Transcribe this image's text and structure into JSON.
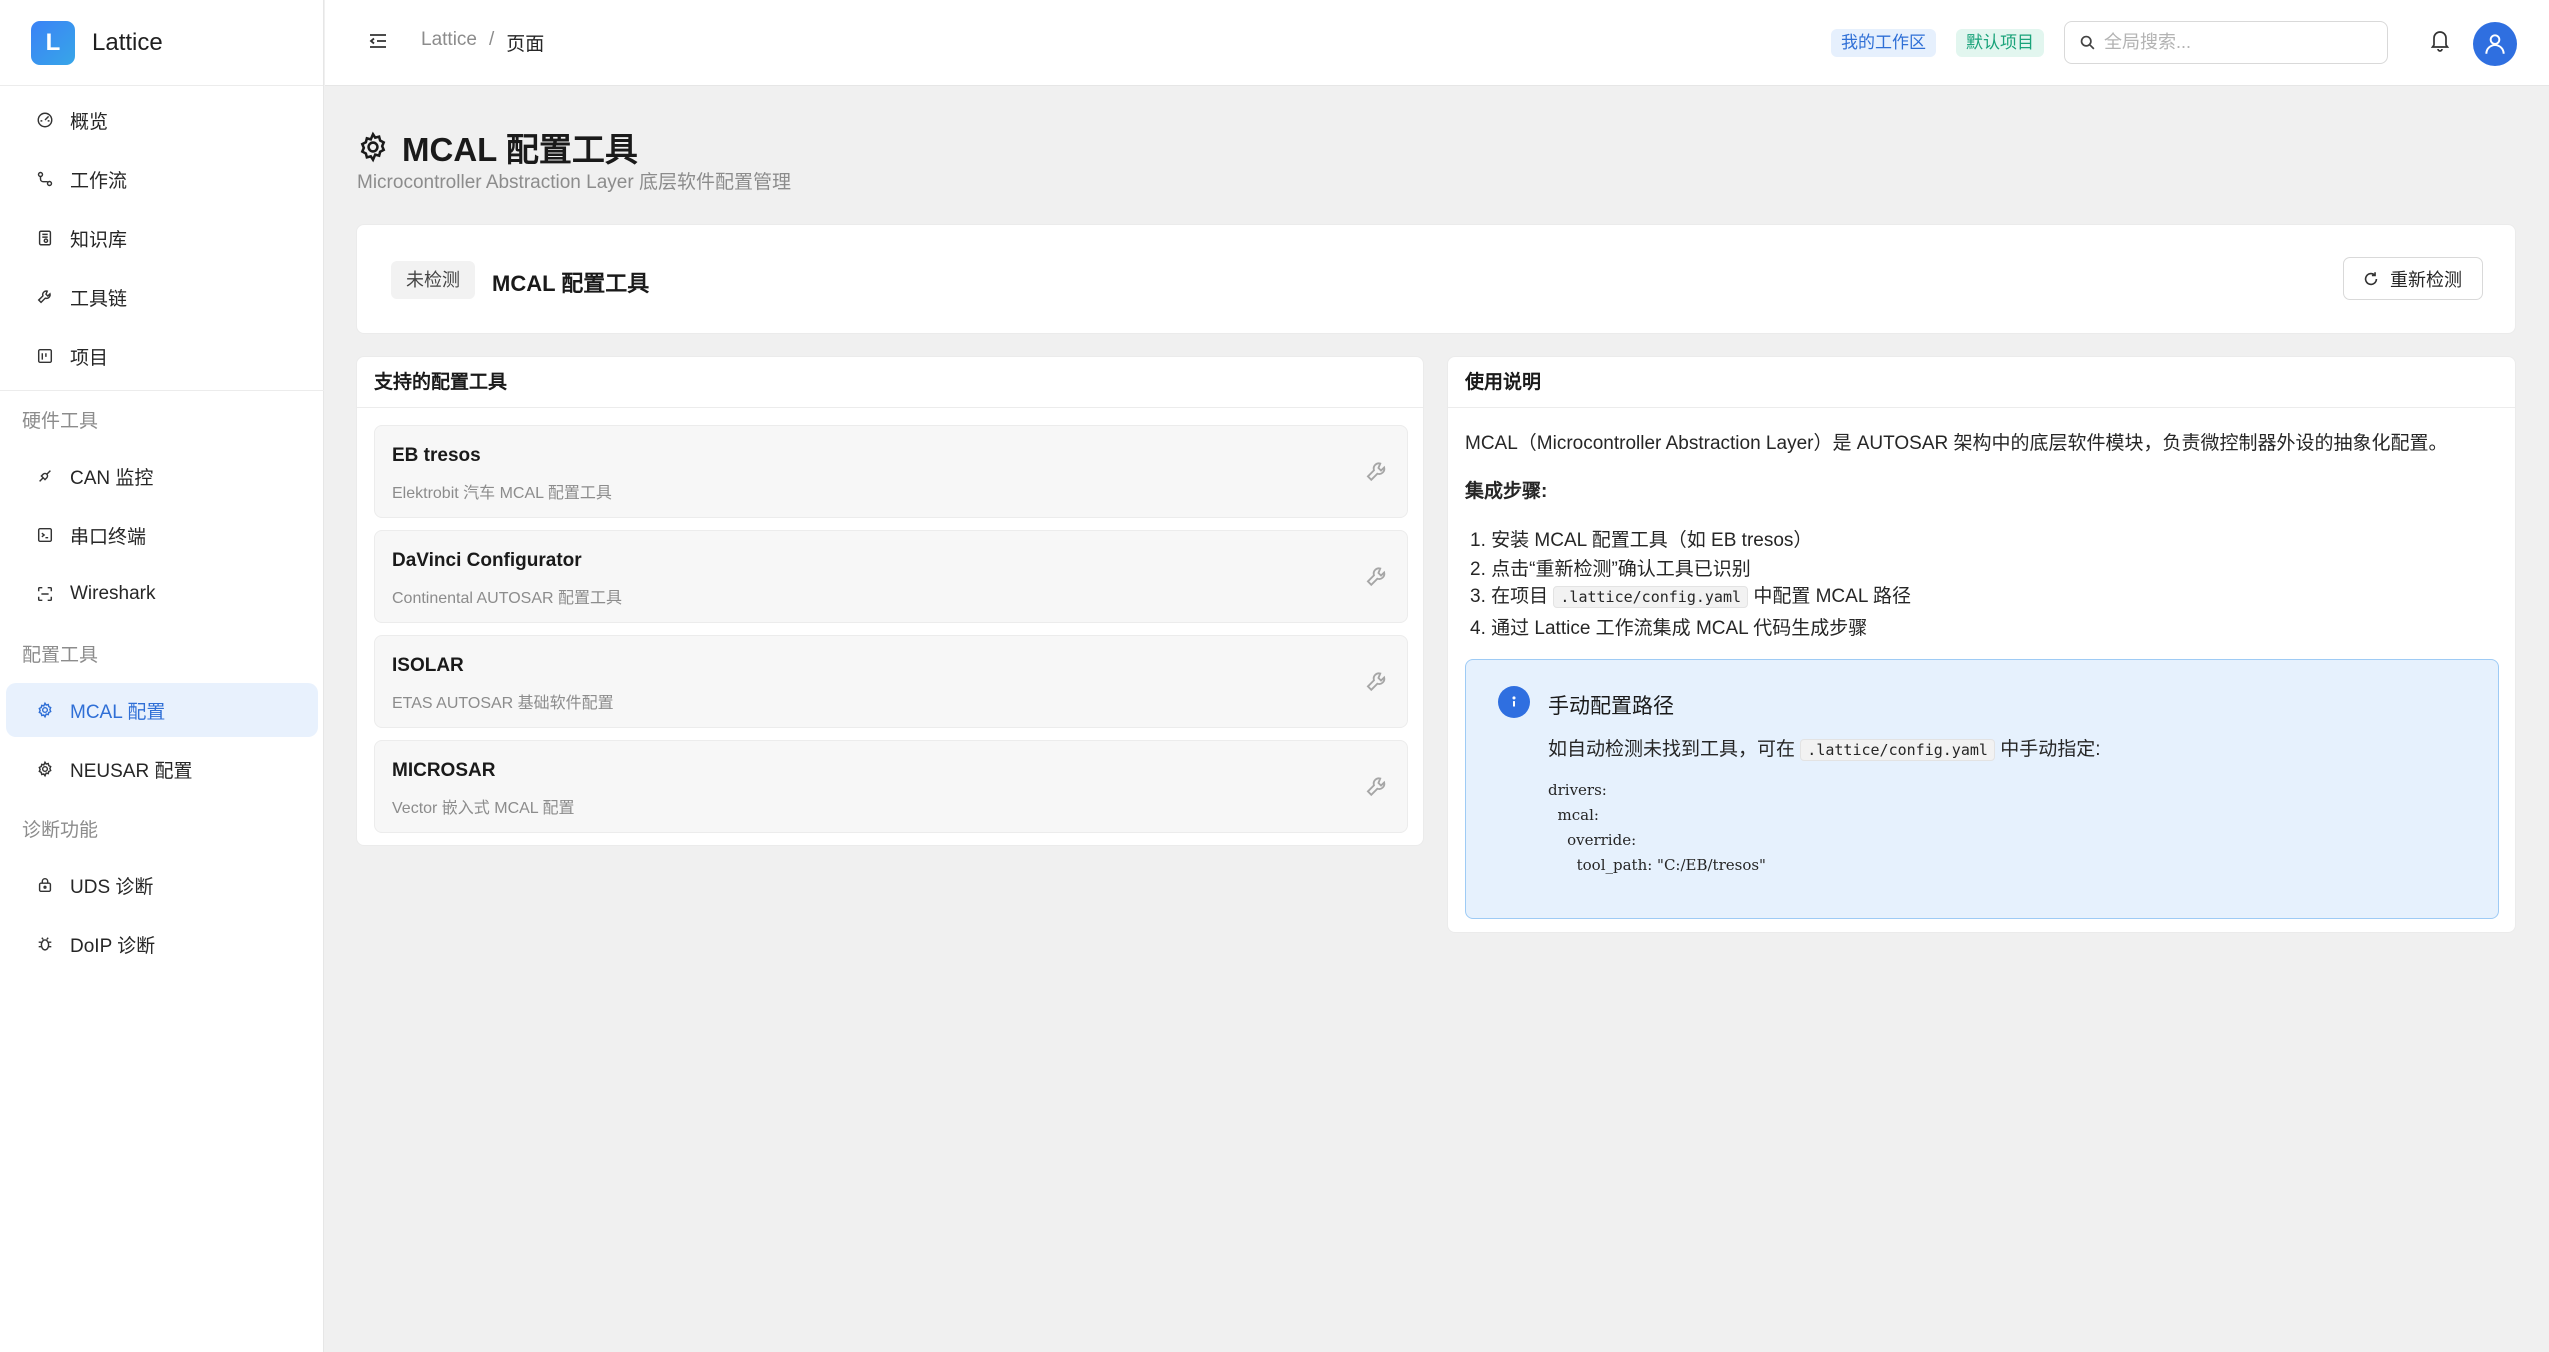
{
  "app": {
    "logo_letter": "L",
    "name": "Lattice"
  },
  "sidebar": {
    "items": [
      {
        "label": "概览",
        "icon": "dashboard-icon"
      },
      {
        "label": "工作流",
        "icon": "workflow-icon"
      },
      {
        "label": "知识库",
        "icon": "book-icon"
      },
      {
        "label": "工具链",
        "icon": "wrench-icon"
      },
      {
        "label": "项目",
        "icon": "project-icon"
      }
    ],
    "sections": [
      {
        "title": "硬件工具",
        "items": [
          {
            "label": "CAN 监控",
            "icon": "plug-icon"
          },
          {
            "label": "串口终端",
            "icon": "terminal-icon"
          },
          {
            "label": "Wireshark",
            "icon": "scan-icon"
          }
        ]
      },
      {
        "title": "配置工具",
        "items": [
          {
            "label": "MCAL 配置",
            "icon": "gear-icon",
            "active": true
          },
          {
            "label": "NEUSAR 配置",
            "icon": "gear-icon"
          }
        ]
      },
      {
        "title": "诊断功能",
        "items": [
          {
            "label": "UDS 诊断",
            "icon": "lock-icon"
          },
          {
            "label": "DoIP 诊断",
            "icon": "bug-icon"
          }
        ]
      }
    ]
  },
  "header": {
    "breadcrumb": {
      "root": "Lattice",
      "separator": "/",
      "current": "页面"
    },
    "workspace_tag": "我的工作区",
    "project_tag": "默认项目",
    "search_placeholder": "全局搜索..."
  },
  "page": {
    "title": "MCAL 配置工具",
    "subtitle": "Microcontroller Abstraction Layer 底层软件配置管理"
  },
  "status": {
    "badge": "未检测",
    "title": "MCAL 配置工具",
    "recheck_label": "重新检测"
  },
  "tools": {
    "header": "支持的配置工具",
    "items": [
      {
        "name": "EB tresos",
        "desc": "Elektrobit 汽车 MCAL 配置工具"
      },
      {
        "name": "DaVinci Configurator",
        "desc": "Continental AUTOSAR 配置工具"
      },
      {
        "name": "ISOLAR",
        "desc": "ETAS AUTOSAR 基础软件配置"
      },
      {
        "name": "MICROSAR",
        "desc": "Vector 嵌入式 MCAL 配置"
      }
    ]
  },
  "help": {
    "header": "使用说明",
    "intro": "MCAL（Microcontroller Abstraction Layer）是 AUTOSAR 架构中的底层软件模块，负责微控制器外设的抽象化配置。",
    "steps_title": "集成步骤:",
    "step1": "1. 安装 MCAL 配置工具（如 EB tresos）",
    "step2": "2. 点击“重新检测”确认工具已识别",
    "step3_pre": "3. 在项目",
    "step3_code": ".lattice/config.yaml",
    "step3_post": "中配置 MCAL 路径",
    "step4": "4. 通过 Lattice 工作流集成 MCAL 代码生成步骤",
    "info": {
      "title": "手动配置路径",
      "desc_pre": "如自动检测未找到工具，可在",
      "desc_code": ".lattice/config.yaml",
      "desc_post": "中手动指定:",
      "code": "drivers:\n  mcal:\n    override:\n      tool_path: \"C:/EB/tresos\""
    }
  },
  "colors": {
    "accent": "#2f6fe0",
    "active_bg": "#e8f1fd",
    "info_bg": "#e6f1fd"
  }
}
